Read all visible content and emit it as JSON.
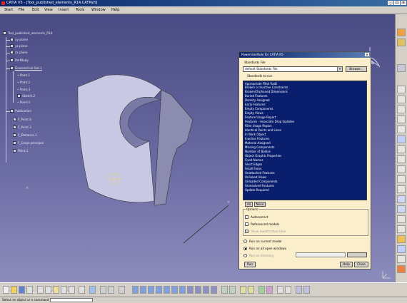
{
  "window": {
    "title": "CATIA V5 - [Tool_published_elements_R14.CATPart]"
  },
  "menubar": {
    "items": [
      "Start",
      "File",
      "Edit",
      "View",
      "Insert",
      "Tools",
      "Window",
      "Help"
    ]
  },
  "tree": {
    "root": "Tool_published_elements_R14",
    "nodes": [
      "xy plane",
      "yz plane",
      "zx plane",
      "PartBody",
      "Geometrical Set.1",
      "Point.1",
      "Point.2",
      "Point.3",
      "Sketch.2",
      "Point.4",
      "Publication",
      "F_Point.4",
      "F_Point.3",
      "F_Distance.1",
      "F_Corps principal",
      "Point.1"
    ]
  },
  "dialog": {
    "title": "PowerUserRule for CATIA R5",
    "standards_file_label": "Standards File",
    "standards_file_value": "default Standards File",
    "browse_label": "Browse...",
    "standards_to_run_label": "Standards to run",
    "standards": [
      "Appropriate Fillet Radii",
      "Broken or Inactive Constraints",
      "Broken/Orphaned Dimensions",
      "Buried Features",
      "Density Assigned",
      "Early Features",
      "Empty Components",
      "Empty Views",
      "Feature Usage Report",
      "Features - Associate Drop Updates",
      "Fillet Usage Report",
      "Identical Points and Lines",
      "In Work Object",
      "Inactive Features",
      "Material Assigned",
      "Missing Components",
      "Number of Bodies",
      "Object Graphic Properties",
      "Fixed Names",
      "Short Edges",
      "Small Faces",
      "Unattached Features",
      "Unlinked Views",
      "Unloaded Components",
      "Unresolved Features",
      "Update Required"
    ],
    "all_label": "All",
    "none_label": "None",
    "options_label": "Options",
    "options": [
      "Autocorrect",
      "Referenced models",
      "Show modification time"
    ],
    "run_modes": [
      "Run on current model",
      "Run on all open windows",
      "Run on directory"
    ],
    "selected_run_mode": "Run on all open windows",
    "run_label": "Run",
    "help_label": "Help",
    "close_label": "Close"
  },
  "statusbar": {
    "text": "Select an object or a command"
  },
  "colors": {
    "viewport_top": "#4a4a84",
    "viewport_bottom": "#8c8cbc",
    "dialog_bg": "#fbeecb",
    "list_bg": "#0a1e6e"
  }
}
